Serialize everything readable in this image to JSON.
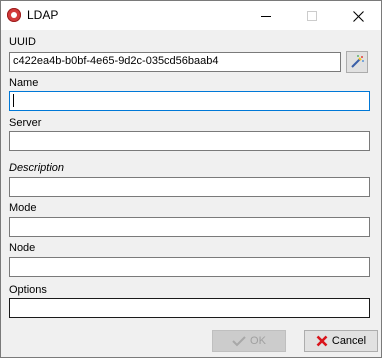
{
  "window": {
    "title": "LDAP",
    "icons": {
      "app": "app-logo-icon",
      "minimize": "minimize-icon",
      "maximize": "maximize-icon",
      "close": "close-icon"
    }
  },
  "form": {
    "uuid": {
      "label": "UUID",
      "value": "c422ea4b-b0bf-4e65-9d2c-035cd56baab4",
      "generate_icon": "magic-wand-icon"
    },
    "name": {
      "label": "Name",
      "value": ""
    },
    "server": {
      "label": "Server",
      "value": ""
    },
    "description": {
      "label": "Description",
      "value": ""
    },
    "mode": {
      "label": "Mode",
      "value": ""
    },
    "node": {
      "label": "Node",
      "value": ""
    },
    "options": {
      "label": "Options",
      "value": ""
    }
  },
  "footer": {
    "ok_label": "OK",
    "cancel_label": "Cancel",
    "ok_icon": "checkmark-icon",
    "cancel_icon": "x-icon"
  },
  "colors": {
    "focus": "#0078d7",
    "cancel_x": "#d9141b"
  }
}
